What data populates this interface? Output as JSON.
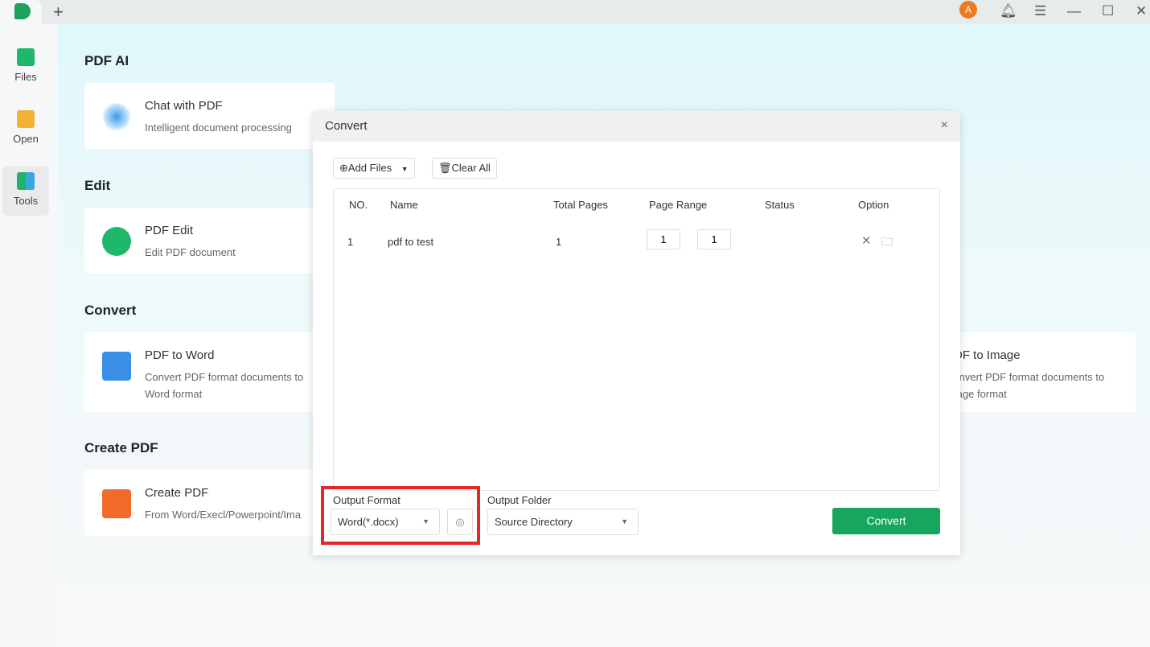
{
  "topbar": {
    "new_tab": "+",
    "avatar_letter": "A",
    "icons": [
      "bell-icon",
      "menu-icon",
      "minimize-icon",
      "maximize-icon",
      "close-icon"
    ]
  },
  "sidebar": {
    "items": [
      {
        "label": "Files",
        "icon": "files-icon",
        "color": "#1fb86a"
      },
      {
        "label": "Open",
        "icon": "open-icon",
        "color": "#f2b233"
      },
      {
        "label": "Tools",
        "icon": "tools-icon",
        "color": "#3aa8e0"
      }
    ]
  },
  "sections": [
    {
      "title": "PDF AI",
      "cards": [
        {
          "title": "Chat with PDF",
          "subtitle": "Intelligent document processing"
        }
      ]
    },
    {
      "title": "Edit",
      "cards": [
        {
          "title": "PDF Edit",
          "subtitle": "Edit PDF document"
        }
      ]
    },
    {
      "title": "Convert",
      "cards": [
        {
          "title": "PDF to Word",
          "subtitle": "Convert PDF format documents to Word format"
        },
        {
          "title": "PDF to Image",
          "subtitle": "Convert PDF format documents to image format"
        }
      ]
    },
    {
      "title": "Create PDF",
      "cards": [
        {
          "title": "Create PDF",
          "subtitle": "From Word/Execl/Powerpoint/Ima"
        }
      ]
    }
  ],
  "dialog": {
    "title": "Convert",
    "close": "×",
    "add_files": "Add Files",
    "clear_all": "Clear All",
    "columns": [
      "NO.",
      "Name",
      "Total Pages",
      "Page Range",
      "Status",
      "Option"
    ],
    "rows": [
      {
        "no": "1",
        "name": "pdf to test",
        "total_pages": "1",
        "range_from": "1",
        "range_to": "1",
        "status": ""
      }
    ],
    "output_format_label": "Output Format",
    "output_format": "Word(*.docx)",
    "output_folder_label": "Output Folder",
    "output_folder": "Source Directory",
    "convert": "Convert"
  },
  "colors": {
    "accent": "#17a65d",
    "highlight": "#e5262b",
    "avatar": "#f07a1f"
  }
}
